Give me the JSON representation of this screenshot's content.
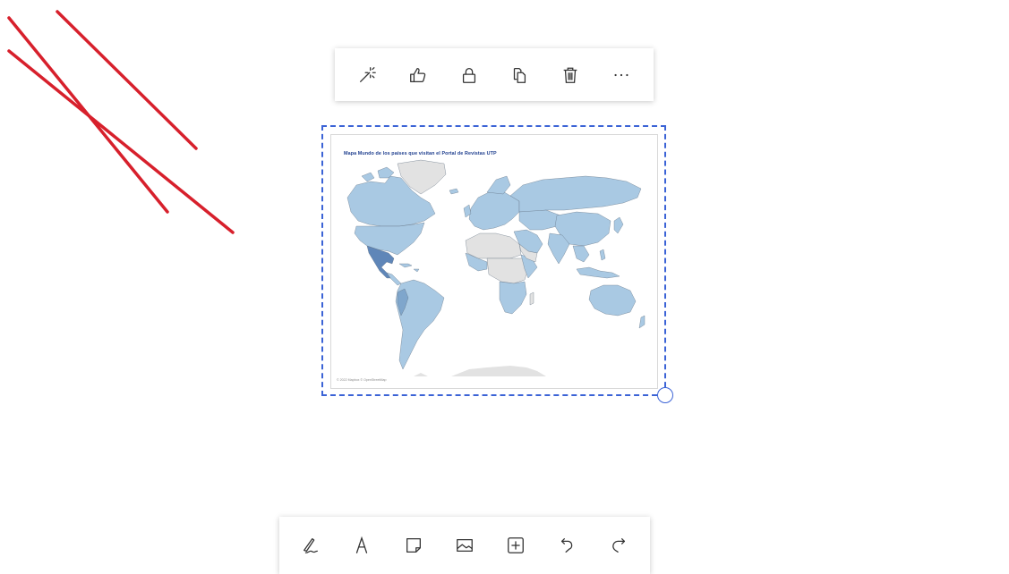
{
  "canvas": {
    "background": "#ffffff",
    "ink_color": "#d7202c"
  },
  "context_toolbar": {
    "buttons": [
      {
        "icon": "magic-wand-icon"
      },
      {
        "icon": "thumbs-up-icon"
      },
      {
        "icon": "lock-icon"
      },
      {
        "icon": "copy-icon"
      },
      {
        "icon": "trash-icon"
      },
      {
        "icon": "more-icon"
      }
    ]
  },
  "map_image": {
    "title": "Mapa Mundo de los países que visitan el Portal de Revistas UTP",
    "attribution": "© 2022 Mapbox © OpenStreetMap",
    "colors": {
      "land_default": "#e2e2e2",
      "visited": "#a9c9e3",
      "highlight": "#5f86b8",
      "border": "#5f6f80"
    }
  },
  "main_toolbar": {
    "buttons": [
      {
        "icon": "pen-icon"
      },
      {
        "icon": "text-icon"
      },
      {
        "icon": "sticky-note-icon"
      },
      {
        "icon": "image-icon"
      },
      {
        "icon": "add-box-icon"
      },
      {
        "icon": "undo-icon"
      },
      {
        "icon": "redo-icon"
      }
    ]
  },
  "selection": {
    "accent": "#3b63d6"
  }
}
